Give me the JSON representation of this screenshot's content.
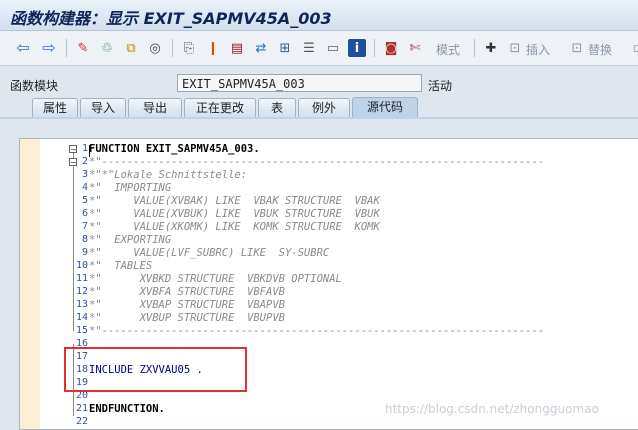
{
  "window": {
    "title": "函数构建器：显示 EXIT_SAPMV45A_003"
  },
  "toolbar": {
    "mode_label": "模式",
    "insert_label": "插入",
    "replace_label": "替换"
  },
  "header": {
    "field_label": "函数模块",
    "field_value": "EXIT_SAPMV45A_003",
    "status": "活动"
  },
  "tabs": [
    {
      "label": "属性"
    },
    {
      "label": "导入"
    },
    {
      "label": "导出"
    },
    {
      "label": "正在更改"
    },
    {
      "label": "表"
    },
    {
      "label": "例外"
    },
    {
      "label": "源代码"
    }
  ],
  "active_tab": "源代码",
  "editor": {
    "line_numbers": [
      "1",
      "2",
      "3",
      "4",
      "5",
      "6",
      "7",
      "8",
      "9",
      "10",
      "11",
      "12",
      "13",
      "14",
      "15",
      "16",
      "17",
      "18",
      "19",
      "20",
      "21",
      "22"
    ],
    "lines": [
      "FUNCTION EXIT_SAPMV45A_003.",
      "*\"----------------------------------------------------------------------",
      "*\"*\"Lokale Schnittstelle:",
      "*\"  IMPORTING",
      "*\"     VALUE(XVBAK) LIKE  VBAK STRUCTURE  VBAK",
      "*\"     VALUE(XVBUK) LIKE  VBUK STRUCTURE  VBUK",
      "*\"     VALUE(XKOMK) LIKE  KOMK STRUCTURE  KOMK",
      "*\"  EXPORTING",
      "*\"     VALUE(LVF_SUBRC) LIKE  SY-SUBRC",
      "*\"  TABLES",
      "*\"      XVBKD STRUCTURE  VBKDVB OPTIONAL",
      "*\"      XVBFA STRUCTURE  VBFAVB",
      "*\"      XVBAP STRUCTURE  VBAPVB",
      "*\"      XVBUP STRUCTURE  VBUPVB",
      "*\"----------------------------------------------------------------------",
      "",
      "",
      "INCLUDE ZXVVAU05 .",
      "",
      "",
      "ENDFUNCTION.",
      ""
    ]
  },
  "watermark": "https://blog.csdn.net/zhongguomao"
}
